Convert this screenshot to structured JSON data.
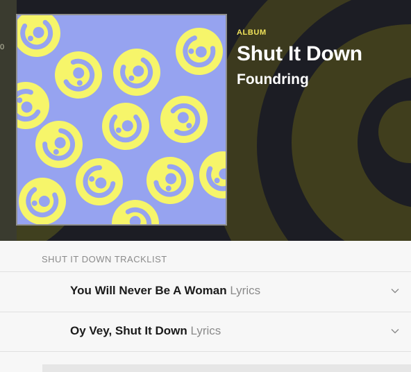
{
  "album": {
    "label": "ALBUM",
    "title": "Shut It Down",
    "artist": "Foundring"
  },
  "sidebar_fragment": "0",
  "tracklist": {
    "heading": "SHUT IT DOWN TRACKLIST",
    "tracks": [
      {
        "title": "You Will Never Be A Woman",
        "suffix": "Lyrics"
      },
      {
        "title": "Oy Vey, Shut It Down",
        "suffix": "Lyrics"
      }
    ]
  },
  "colors": {
    "hero_bg": "#1c1d24",
    "accent": "#f0e35a",
    "cover_bg": "#96a3f0",
    "cover_face": "#f6f56a"
  },
  "icons": {
    "expand": "chevron-down-icon"
  }
}
